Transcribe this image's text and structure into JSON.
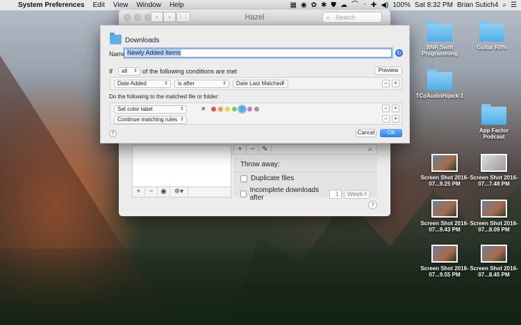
{
  "menubar": {
    "apple_glyph": "",
    "app_name": "System Preferences",
    "menus": [
      "Edit",
      "View",
      "Window",
      "Help"
    ],
    "status_icons": [
      "▦",
      "◉",
      "✿",
      "✱",
      "⛊",
      "☁",
      "⌒",
      "᛫",
      "✚",
      "◀)"
    ],
    "battery": "100%",
    "clock": "Sat 8:32 PM",
    "user": "Brian Sutich4",
    "search_glyph": "⌕",
    "notif_glyph": "☰"
  },
  "hazel_window": {
    "title": "Hazel",
    "nav_back": "‹",
    "nav_forward": "›",
    "grid_glyph": "⋮⋮",
    "search_placeholder": "Search",
    "list_footer": [
      "+",
      "−",
      "◉",
      "✲▾"
    ],
    "rules_footer": [
      "+",
      "−",
      "✎"
    ],
    "throw_away_heading": "Throw away:",
    "duplicate_files_label": "Duplicate files",
    "incomplete_downloads_label": "Incomplete downloads after",
    "incomplete_after_value": "1",
    "incomplete_after_unit": "Week",
    "help": "?"
  },
  "rule_sheet": {
    "folder_name": "Downloads",
    "name_label": "Name:",
    "name_value": "Newly Added Items",
    "if_label": "If",
    "match_mode": "all",
    "conditions_text": "of the following conditions are met",
    "preview_label": "Preview",
    "conditions": [
      {
        "attribute": "Date Added",
        "operator": "is after",
        "value": "Date Last Matched"
      }
    ],
    "actions_heading": "Do the following to the matched file or folder:",
    "actions": [
      {
        "action": "Set color label",
        "clear_glyph": "✕"
      },
      {
        "action": "Continue matching rules"
      }
    ],
    "label_colors": [
      "#e8504a",
      "#f29d38",
      "#f4d046",
      "#7bcc5c",
      "#5aa9e8",
      "#c47ad9",
      "#9a9a9a"
    ],
    "selected_color_index": 4,
    "help": "?",
    "cancel_label": "Cancel",
    "ok_label": "OK",
    "plus": "+",
    "minus": "−"
  },
  "desktop_icons": [
    {
      "label": "BNR Swift Programming",
      "kind": "folder"
    },
    {
      "label": "Guitar Riffs",
      "kind": "folder"
    },
    {
      "label": "TCoAudioHijack-1",
      "kind": "folder"
    },
    {
      "label": "App Factor Podcast",
      "kind": "folder"
    },
    {
      "label": "Screen Shot 2016-07...9.25 PM",
      "kind": "screenshot"
    },
    {
      "label": "Screen Shot 2016-07...7.48 PM",
      "kind": "screenshot"
    },
    {
      "label": "Screen Shot 2016-07...9.43 PM",
      "kind": "screenshot"
    },
    {
      "label": "Screen Shot 2016-07...8.09 PM",
      "kind": "screenshot"
    },
    {
      "label": "Screen Shot 2016-07...9.55 PM",
      "kind": "screenshot"
    },
    {
      "label": "Screen Shot 2016-07...8.45 PM",
      "kind": "screenshot"
    }
  ]
}
